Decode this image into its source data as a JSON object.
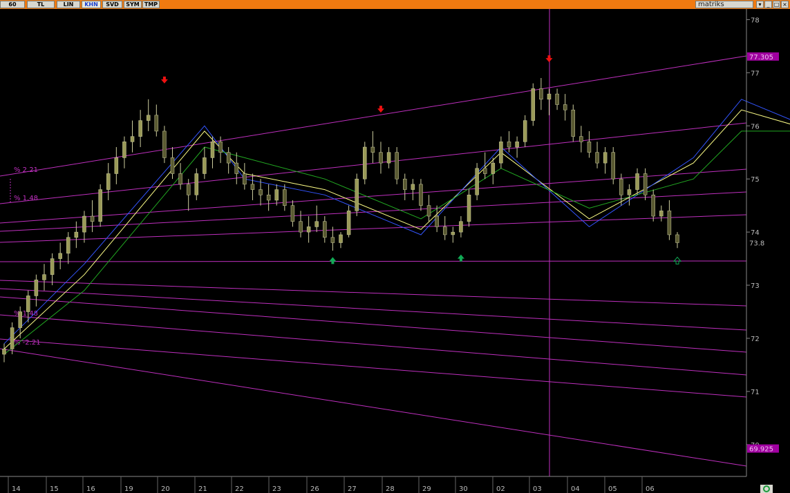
{
  "toolbar": {
    "buttons": [
      {
        "label": "60",
        "active": false
      },
      {
        "label": "TL",
        "active": false
      },
      {
        "label": "LIN",
        "active": false
      },
      {
        "label": "KHN",
        "active": true
      },
      {
        "label": "SVD",
        "active": false
      },
      {
        "label": "SYM",
        "active": false
      },
      {
        "label": "TMP",
        "active": false
      }
    ],
    "brand": "matriks",
    "window_controls": [
      "arrow-down-icon",
      "minimize-icon",
      "maximize-icon",
      "close-icon"
    ]
  },
  "colors": {
    "background": "#000000",
    "toolbar": "#f07a10",
    "candle_body": "#9a9a58",
    "candle_wick": "#cfcfa0",
    "ma_yellow": "#ffff88",
    "ma_blue": "#3355ff",
    "ma_green": "#22aa22",
    "trend_line": "#c030c0",
    "price_tag_bg": "#a000a0",
    "arrow_up": "#11aa55",
    "arrow_down": "#ee1111"
  },
  "chart_data": {
    "type": "candlestick",
    "title": "",
    "xlabel": "",
    "ylabel": "",
    "ylim": [
      69.4,
      78.2
    ],
    "y_ticks": [
      70,
      71,
      72,
      73,
      74,
      75,
      76,
      77,
      78
    ],
    "x_tick_labels": [
      "14",
      "15",
      "16",
      "19",
      "20",
      "21",
      "22",
      "23",
      "26",
      "27",
      "28",
      "29",
      "30",
      "02",
      "03",
      "04",
      "05",
      "06"
    ],
    "price_tags": [
      {
        "value": 77.305,
        "label": "77.305",
        "style": "highlight"
      },
      {
        "value": 73.8,
        "label": "73.8",
        "style": "plain"
      },
      {
        "value": 69.925,
        "label": "69.925",
        "style": "highlight"
      }
    ],
    "fib_labels": [
      "% 2.21",
      "% 1.48",
      "% 1.48",
      "% -2.21"
    ],
    "series": [
      {
        "name": "",
        "kind": "candles",
        "values": [
          [
            71.7,
            71.9,
            71.55,
            71.8
          ],
          [
            71.8,
            72.3,
            71.7,
            72.2
          ],
          [
            72.2,
            72.6,
            72.0,
            72.5
          ],
          [
            72.5,
            72.9,
            72.3,
            72.8
          ],
          [
            72.8,
            73.2,
            72.6,
            73.1
          ],
          [
            73.1,
            73.4,
            72.9,
            73.2
          ],
          [
            73.2,
            73.6,
            73.0,
            73.5
          ],
          [
            73.5,
            73.8,
            73.3,
            73.6
          ],
          [
            73.6,
            74.0,
            73.4,
            73.9
          ],
          [
            73.9,
            74.2,
            73.7,
            74.0
          ],
          [
            74.0,
            74.4,
            73.8,
            74.3
          ],
          [
            74.3,
            74.6,
            74.0,
            74.2
          ],
          [
            74.2,
            74.9,
            74.1,
            74.8
          ],
          [
            74.8,
            75.3,
            74.6,
            75.1
          ],
          [
            75.1,
            75.6,
            74.9,
            75.4
          ],
          [
            75.4,
            75.8,
            75.2,
            75.7
          ],
          [
            75.7,
            76.1,
            75.5,
            75.8
          ],
          [
            75.8,
            76.3,
            75.6,
            76.1
          ],
          [
            76.1,
            76.5,
            75.9,
            76.2
          ],
          [
            76.2,
            76.4,
            75.8,
            75.9
          ],
          [
            75.9,
            76.0,
            75.3,
            75.4
          ],
          [
            75.4,
            75.6,
            75.0,
            75.1
          ],
          [
            75.1,
            75.3,
            74.8,
            74.9
          ],
          [
            74.9,
            75.0,
            74.4,
            74.7
          ],
          [
            74.7,
            75.2,
            74.6,
            75.1
          ],
          [
            75.1,
            75.6,
            75.0,
            75.4
          ],
          [
            75.4,
            75.8,
            75.2,
            75.7
          ],
          [
            75.7,
            75.8,
            75.3,
            75.5
          ],
          [
            75.5,
            75.6,
            75.1,
            75.3
          ],
          [
            75.3,
            75.5,
            74.9,
            75.1
          ],
          [
            75.1,
            75.3,
            74.8,
            74.9
          ],
          [
            74.9,
            75.1,
            74.6,
            74.8
          ],
          [
            74.8,
            75.0,
            74.5,
            74.7
          ],
          [
            74.7,
            74.9,
            74.4,
            74.6
          ],
          [
            74.6,
            74.9,
            74.5,
            74.8
          ],
          [
            74.8,
            74.9,
            74.4,
            74.5
          ],
          [
            74.5,
            74.6,
            74.1,
            74.2
          ],
          [
            74.2,
            74.4,
            73.9,
            74.0
          ],
          [
            74.0,
            74.3,
            73.8,
            74.1
          ],
          [
            74.1,
            74.5,
            74.0,
            74.2
          ],
          [
            74.2,
            74.3,
            73.8,
            73.9
          ],
          [
            73.9,
            74.1,
            73.65,
            73.8
          ],
          [
            73.8,
            74.0,
            73.7,
            73.95
          ],
          [
            73.95,
            74.5,
            73.9,
            74.4
          ],
          [
            74.4,
            75.1,
            74.3,
            75.0
          ],
          [
            75.0,
            75.7,
            74.9,
            75.6
          ],
          [
            75.6,
            75.9,
            75.3,
            75.5
          ],
          [
            75.5,
            75.7,
            75.1,
            75.3
          ],
          [
            75.3,
            75.6,
            75.2,
            75.5
          ],
          [
            75.5,
            75.6,
            74.9,
            75.0
          ],
          [
            75.0,
            75.1,
            74.6,
            74.8
          ],
          [
            74.8,
            75.0,
            74.6,
            74.9
          ],
          [
            74.9,
            75.0,
            74.4,
            74.5
          ],
          [
            74.5,
            74.7,
            74.2,
            74.3
          ],
          [
            74.3,
            74.5,
            74.0,
            74.1
          ],
          [
            74.1,
            74.3,
            73.85,
            73.95
          ],
          [
            73.95,
            74.1,
            73.8,
            74.0
          ],
          [
            74.0,
            74.3,
            73.9,
            74.2
          ],
          [
            74.2,
            74.8,
            74.1,
            74.7
          ],
          [
            74.7,
            75.3,
            74.6,
            75.2
          ],
          [
            75.2,
            75.5,
            75.0,
            75.1
          ],
          [
            75.1,
            75.4,
            74.9,
            75.3
          ],
          [
            75.3,
            75.8,
            75.2,
            75.7
          ],
          [
            75.7,
            75.9,
            75.5,
            75.6
          ],
          [
            75.6,
            75.8,
            75.4,
            75.7
          ],
          [
            75.7,
            76.2,
            75.6,
            76.1
          ],
          [
            76.1,
            76.8,
            76.0,
            76.7
          ],
          [
            76.7,
            76.9,
            76.3,
            76.5
          ],
          [
            76.5,
            76.7,
            76.2,
            76.6
          ],
          [
            76.6,
            76.7,
            76.3,
            76.4
          ],
          [
            76.4,
            76.6,
            76.1,
            76.3
          ],
          [
            76.3,
            76.4,
            75.7,
            75.8
          ],
          [
            75.8,
            76.0,
            75.5,
            75.7
          ],
          [
            75.7,
            75.9,
            75.4,
            75.5
          ],
          [
            75.5,
            75.7,
            75.2,
            75.3
          ],
          [
            75.3,
            75.6,
            75.1,
            75.5
          ],
          [
            75.5,
            75.6,
            74.9,
            75.0
          ],
          [
            75.0,
            75.1,
            74.5,
            74.7
          ],
          [
            74.7,
            74.9,
            74.5,
            74.8
          ],
          [
            74.8,
            75.2,
            74.7,
            75.1
          ],
          [
            75.1,
            75.2,
            74.6,
            74.7
          ],
          [
            74.7,
            74.8,
            74.2,
            74.3
          ],
          [
            74.3,
            74.5,
            74.2,
            74.4
          ],
          [
            74.4,
            74.6,
            73.85,
            73.95
          ],
          [
            73.95,
            74.0,
            73.7,
            73.8
          ]
        ]
      },
      {
        "name": "",
        "kind": "ma",
        "color_key": "ma_yellow",
        "values": [
          [
            0,
            71.8
          ],
          [
            10,
            73.2
          ],
          [
            25,
            75.9
          ],
          [
            30,
            75.1
          ],
          [
            40,
            74.8
          ],
          [
            52,
            74.05
          ],
          [
            62,
            75.5
          ],
          [
            73,
            74.25
          ],
          [
            86,
            75.3
          ],
          [
            92,
            76.3
          ],
          [
            108,
            75.6
          ],
          [
            122,
            74.8
          ],
          [
            130,
            74.7
          ],
          [
            138,
            74.3
          ]
        ]
      },
      {
        "name": "",
        "kind": "ma",
        "color_key": "ma_blue",
        "values": [
          [
            0,
            71.9
          ],
          [
            10,
            73.4
          ],
          [
            25,
            76.0
          ],
          [
            30,
            75.0
          ],
          [
            40,
            74.7
          ],
          [
            52,
            73.95
          ],
          [
            62,
            75.6
          ],
          [
            73,
            74.1
          ],
          [
            86,
            75.4
          ],
          [
            92,
            76.5
          ],
          [
            108,
            75.5
          ],
          [
            122,
            74.6
          ],
          [
            130,
            74.55
          ],
          [
            138,
            74.2
          ]
        ]
      },
      {
        "name": "",
        "kind": "ma",
        "color_key": "ma_green",
        "values": [
          [
            0,
            71.7
          ],
          [
            10,
            72.9
          ],
          [
            25,
            75.6
          ],
          [
            30,
            75.4
          ],
          [
            40,
            75.0
          ],
          [
            52,
            74.25
          ],
          [
            62,
            75.2
          ],
          [
            73,
            74.45
          ],
          [
            86,
            75.0
          ],
          [
            92,
            75.9
          ],
          [
            108,
            75.9
          ],
          [
            122,
            75.1
          ],
          [
            130,
            74.9
          ],
          [
            138,
            74.5
          ]
        ]
      }
    ],
    "signals": [
      {
        "type": "down",
        "index": 20,
        "value": 76.85
      },
      {
        "type": "down",
        "index": 47,
        "value": 76.3
      },
      {
        "type": "down",
        "index": 68,
        "value": 77.25
      },
      {
        "type": "up",
        "index": 41,
        "value": 73.45
      },
      {
        "type": "up",
        "index": 57,
        "value": 73.5
      },
      {
        "type": "up_hollow",
        "index": 84,
        "value": 73.45
      }
    ],
    "grid": false
  }
}
